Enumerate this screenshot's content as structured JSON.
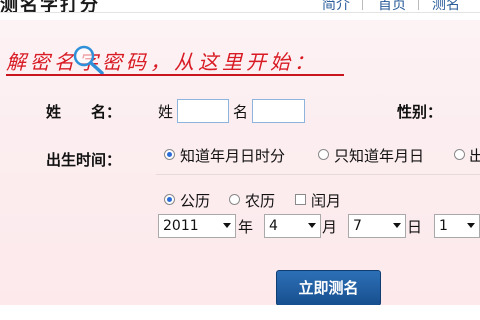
{
  "header": {
    "site_title": "测名字打分",
    "nav": [
      "简介",
      "首页",
      "测名"
    ]
  },
  "slogan": "解密名字密码，从这里开始：",
  "form": {
    "name_label": "姓　　名：",
    "surname_label": "姓",
    "surname_value": "",
    "given_label": "名",
    "given_value": "",
    "gender_label": "性别：",
    "birth_label": "出生时间：",
    "birth_options": [
      "知道年月日时分",
      "只知道年月日",
      "出"
    ],
    "calendar_options": [
      "公历",
      "农历"
    ],
    "leap_label": "闰月",
    "year": "2011",
    "year_unit": "年",
    "month": "4",
    "month_unit": "月",
    "day": "7",
    "day_unit": "日",
    "hour": "1",
    "submit_label": "立即测名"
  },
  "colors": {
    "accent_red": "#d81b24",
    "button_blue": "#1f5ea3",
    "panel_pink": "#fcecee"
  }
}
